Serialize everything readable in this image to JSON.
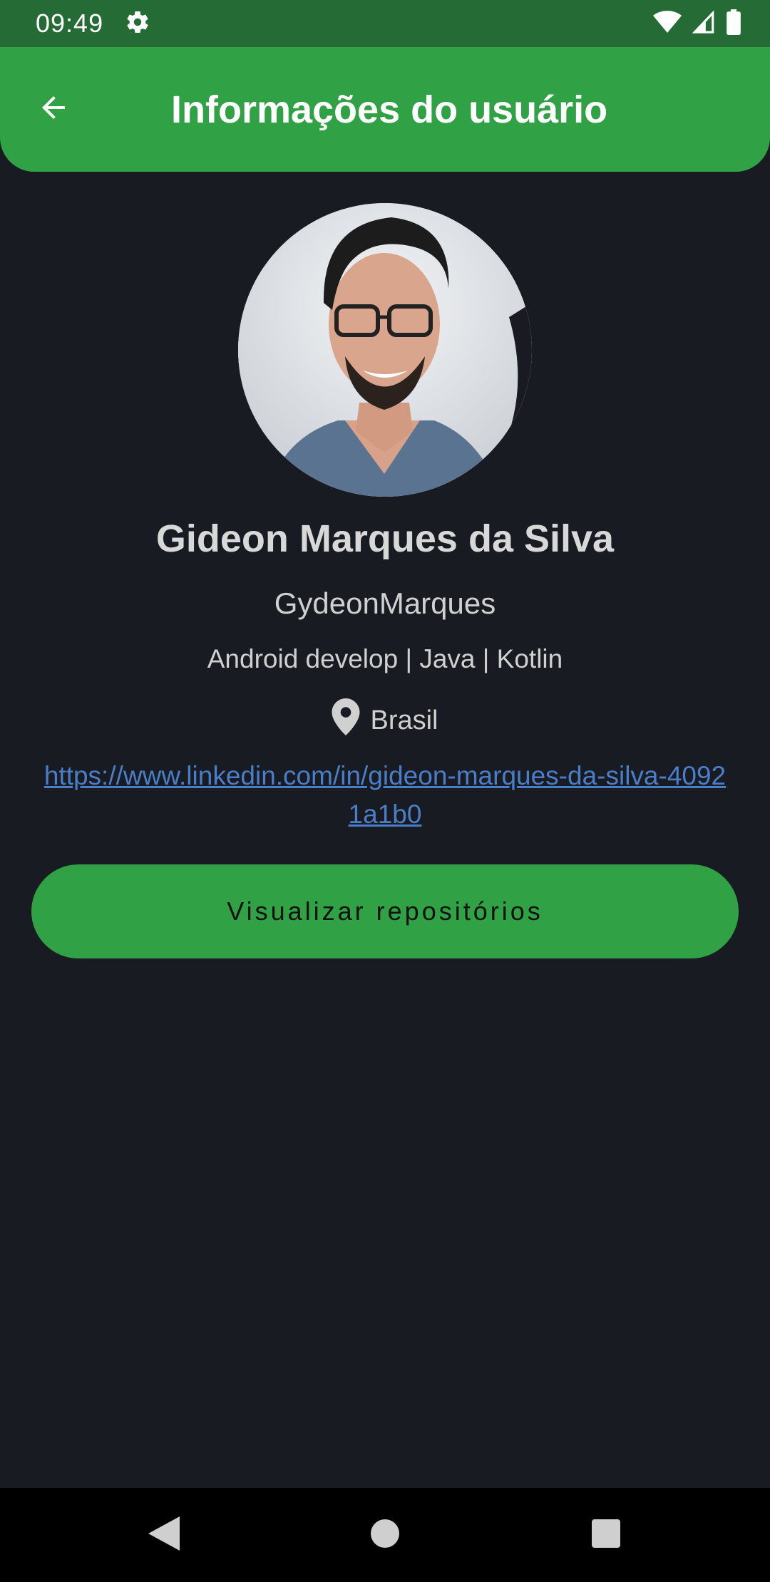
{
  "status_bar": {
    "time": "09:49",
    "icons": [
      "gear-icon",
      "wifi-icon",
      "signal-icon",
      "battery-icon"
    ]
  },
  "app_bar": {
    "title": "Informações do usuário",
    "back_icon": "arrow-back-icon",
    "color": "#31a145"
  },
  "profile": {
    "name": "Gideon Marques da Silva",
    "login": "GydeonMarques",
    "bio": "Android develop | Java | Kotlin",
    "location": "Brasil",
    "location_icon": "location-pin-icon",
    "link": "https://www.linkedin.com/in/gideon-marques-da-silva-40921a1b0"
  },
  "actions": {
    "repositories_label": "Visualizar repositórios"
  },
  "nav_bar": {
    "icons": [
      "back-triangle-icon",
      "home-circle-icon",
      "recents-square-icon"
    ]
  },
  "colors": {
    "background": "#181b21",
    "accent": "#31a145",
    "link": "#4a7ec8"
  }
}
